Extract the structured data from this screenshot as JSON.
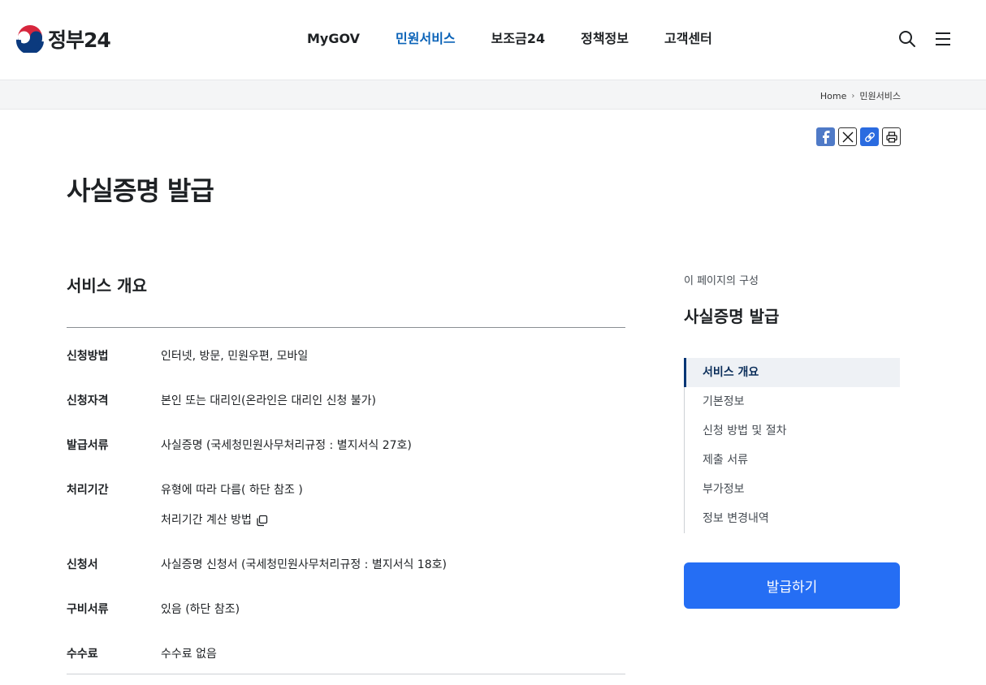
{
  "header": {
    "logo_text": "정부24",
    "nav": [
      "MyGOV",
      "민원서비스",
      "보조금24",
      "정책정보",
      "고객센터"
    ],
    "nav_active": "민원서비스",
    "search_icon": "search-icon",
    "menu_icon": "hamburger-menu-icon",
    "accent_color": "#0b63b8"
  },
  "breadcrumb": {
    "items": [
      "Home",
      "민원서비스"
    ]
  },
  "share": {
    "icons": [
      "facebook-icon",
      "x-icon",
      "link-icon",
      "print-icon"
    ]
  },
  "page_title": "사실증명 발급",
  "overview": {
    "title": "서비스 개요",
    "rows": [
      {
        "label": "신청방법",
        "value": "인터넷, 방문, 민원우편, 모바일"
      },
      {
        "label": "신청자격",
        "value": "본인 또는 대리인(온라인은 대리인 신청 불가)"
      },
      {
        "label": "발급서류",
        "value": "사실증명 (국세청민원사무처리규정 : 별지서식 27호)"
      },
      {
        "label": "처리기간",
        "value": "유형에 따라 다름( 하단 참조 )",
        "sub": "처리기간 계산 방법"
      },
      {
        "label": "신청서",
        "value": "사실증명 신청서 (국세청민원사무처리규정 : 별지서식 18호)"
      },
      {
        "label": "구비서류",
        "value": "있음 (하단 참조)"
      },
      {
        "label": "수수료",
        "value": "수수료 없음"
      }
    ]
  },
  "toc": {
    "caption": "이 페이지의 구성",
    "title": "사실증명 발급",
    "items": [
      "서비스 개요",
      "기본정보",
      "신청 방법 및 절차",
      "제출 서류",
      "부가정보",
      "정보 변경내역"
    ],
    "active": "서비스 개요"
  },
  "issue_button": "발급하기",
  "button_color": "#256ef4"
}
